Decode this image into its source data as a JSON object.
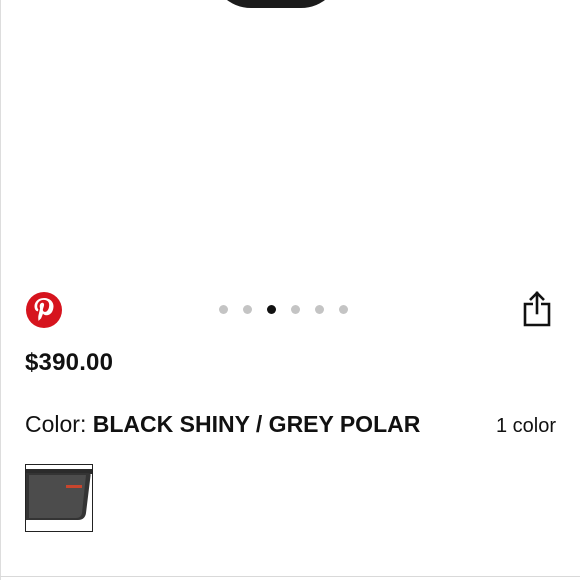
{
  "product": {
    "price": "$390.00",
    "color_label": "Color:",
    "color_name": "BLACK SHINY / GREY POLAR",
    "color_count": "1 color"
  },
  "gallery": {
    "total_images": 6,
    "active_index": 2
  },
  "colors": {
    "pinterest_red": "#d6141e",
    "dot_inactive": "#c4c4c4",
    "dot_active": "#111111",
    "text": "#111111"
  },
  "icons": {
    "pinterest": "pinterest-icon",
    "share": "share-icon"
  }
}
